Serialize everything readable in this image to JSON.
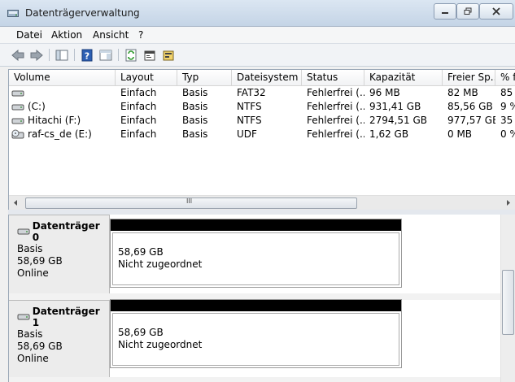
{
  "window": {
    "title": "Datenträgerverwaltung",
    "icon": "disk-management-icon"
  },
  "menu": [
    "Datei",
    "Aktion",
    "Ansicht",
    "?"
  ],
  "toolbar": [
    "back-icon",
    "forward-icon",
    "console-tree-icon",
    "help-icon",
    "properties-panel-icon",
    "refresh-icon",
    "properties-icon",
    "wizard-icon"
  ],
  "volumes": {
    "headers": [
      "Volume",
      "Layout",
      "Typ",
      "Dateisystem",
      "Status",
      "Kapazität",
      "Freier Sp...",
      "% f"
    ],
    "rows": [
      [
        "",
        "Einfach",
        "Basis",
        "FAT32",
        "Fehlerfrei (...",
        "96 MB",
        "82 MB",
        "85"
      ],
      [
        "(C:)",
        "Einfach",
        "Basis",
        "NTFS",
        "Fehlerfrei (...",
        "931,41 GB",
        "85,56 GB",
        "9 %"
      ],
      [
        "Hitachi (F:)",
        "Einfach",
        "Basis",
        "NTFS",
        "Fehlerfrei (...",
        "2794,51 GB",
        "977,57 GB",
        "35"
      ],
      [
        "raf-cs_de (E:)",
        "Einfach",
        "Basis",
        "UDF",
        "Fehlerfrei (...",
        "1,62 GB",
        "0 MB",
        "0 %"
      ]
    ],
    "row_icons": [
      "drive-icon",
      "drive-icon",
      "drive-icon",
      "optical-drive-icon"
    ]
  },
  "hscroll_grip": "III",
  "disks": [
    {
      "name": "Datenträger 0",
      "type": "Basis",
      "size": "58,69 GB",
      "state": "Online",
      "partition_size": "58,69 GB",
      "partition_status": "Nicht zugeordnet"
    },
    {
      "name": "Datenträger 1",
      "type": "Basis",
      "size": "58,69 GB",
      "state": "Online",
      "partition_size": "58,69 GB",
      "partition_status": "Nicht zugeordnet"
    }
  ]
}
